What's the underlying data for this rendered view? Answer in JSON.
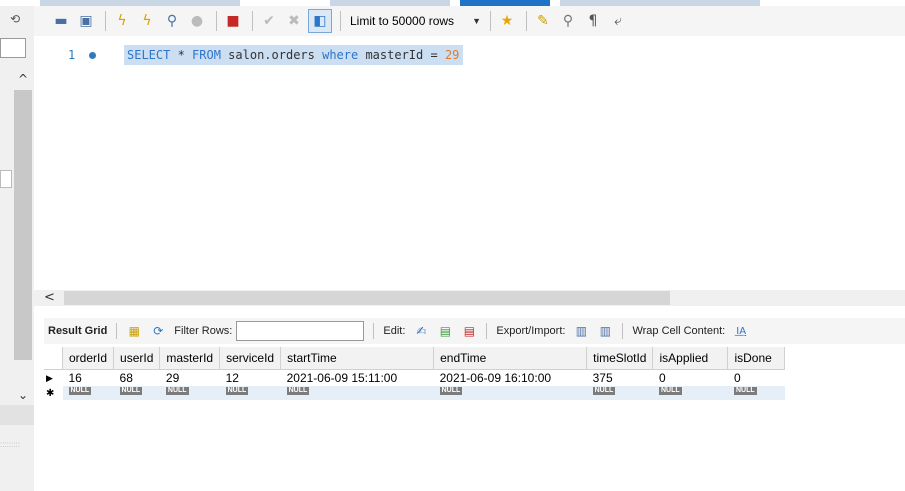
{
  "toolbar": {
    "limit_label": "Limit to 50000 rows",
    "icons": [
      "folder-icon",
      "save-icon",
      "execute-icon",
      "execute-current-icon",
      "explain-icon",
      "stop-icon",
      "error-toggle-icon",
      "commit-icon",
      "rollback-icon",
      "autocommit-icon",
      "limit-dropdown",
      "bookmark-star-icon",
      "beautify-icon",
      "find-icon",
      "invisible-chars-icon",
      "wrap-icon"
    ]
  },
  "editor": {
    "line_number": "1",
    "sql": {
      "kw1": "SELECT",
      "star": " * ",
      "kw2": "FROM",
      "table": " salon.orders ",
      "kw3": "where",
      "cond": " masterId = ",
      "value": "29"
    }
  },
  "results": {
    "result_grid_label": "Result Grid",
    "filter_rows_label": "Filter Rows:",
    "filter_value": "",
    "edit_label": "Edit:",
    "export_label": "Export/Import:",
    "wrap_label": "Wrap Cell Content:",
    "columns": [
      "orderId",
      "userId",
      "masterId",
      "serviceId",
      "startTime",
      "endTime",
      "timeSlotId",
      "isApplied",
      "isDone"
    ],
    "rows": [
      [
        "16",
        "68",
        "29",
        "12",
        "2021-06-09 15:11:00",
        "2021-06-09 16:10:00",
        "375",
        "0",
        "0"
      ]
    ],
    "null_label": "NULL"
  },
  "colors": {
    "keyword": "#2e74c9",
    "number": "#e07a2f",
    "selection": "#cbdef2",
    "active_tab": "#1e73c9"
  }
}
